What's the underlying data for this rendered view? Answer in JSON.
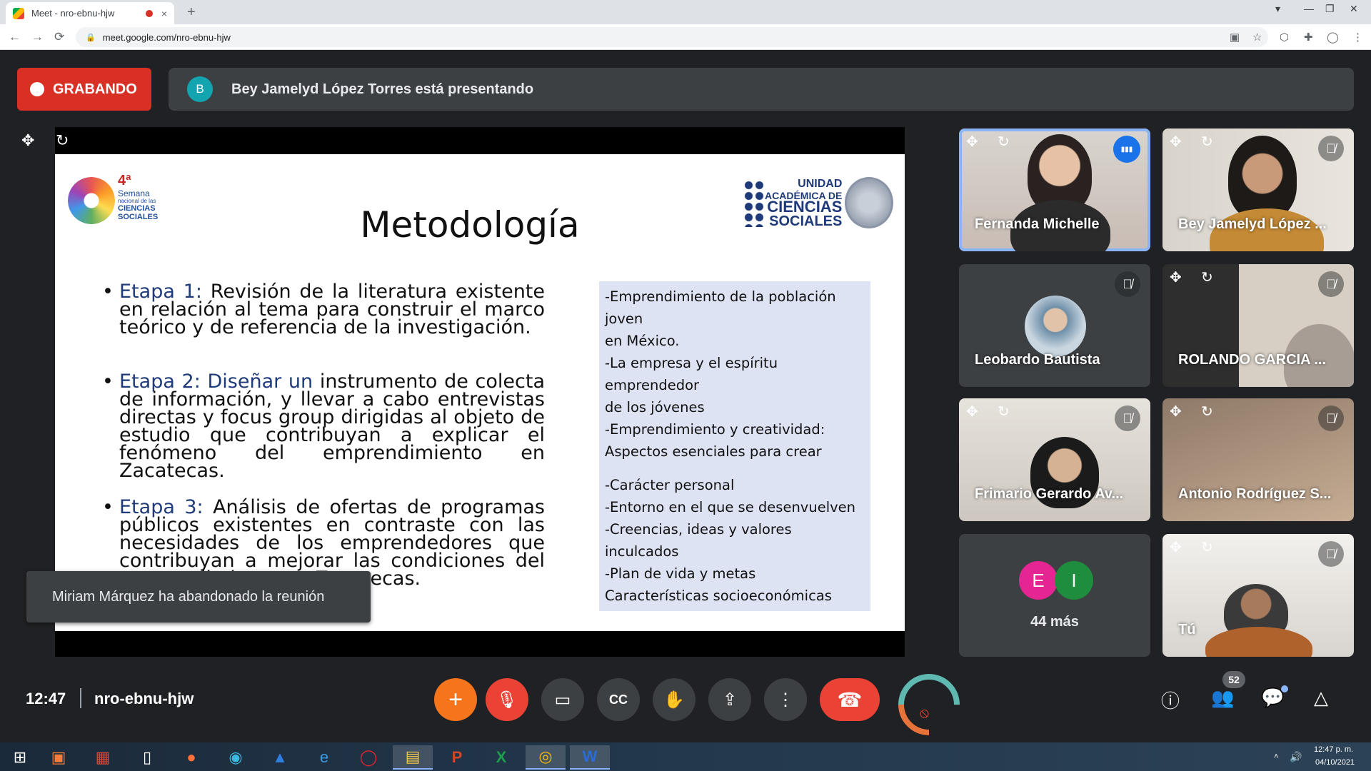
{
  "browser": {
    "tab_title": "Meet - nro-ebnu-hjw",
    "tab_close": "×",
    "new_tab": "+",
    "url": "meet.google.com/nro-ebnu-hjw",
    "lock_icon": "🔒",
    "nav": {
      "back": "←",
      "forward": "→",
      "reload": "⟳"
    },
    "window": {
      "dropdown": "▾",
      "minimize": "—",
      "restore": "❐",
      "close": "✕"
    },
    "extensions": {
      "camera": "▣",
      "star": "☆",
      "cube": "⬡",
      "puzzle": "✚",
      "profile": "◯",
      "menu": "⋮"
    }
  },
  "top": {
    "recording_label": "GRABANDO",
    "presenter_initial": "B",
    "presenter_text": "Bey Jamelyd López Torres está presentando"
  },
  "presentation": {
    "move_icon": "✥",
    "rotate_icon": "↻"
  },
  "slide": {
    "title": "Metodología",
    "logo_left": {
      "line1": "4ª",
      "line2": "Semana",
      "line3": "nacional de las",
      "line4": "CIENCIAS",
      "line5": "SOCIALES"
    },
    "logo_right": {
      "line1": "UNIDAD",
      "line2": "ACADÉMICA DE",
      "line3": "CIENCIAS",
      "line4": "SOCIALES"
    },
    "bullets": [
      {
        "key": "Etapa 1:",
        "text": " Revisión de la literatura existente en relación al tema para construir el marco teórico y de referencia de la investigación."
      },
      {
        "key": "Etapa 2: Diseñar un",
        "text": " instrumento de colecta de información, y llevar a cabo entrevistas directas y focus group dirigidas al objeto de estudio que contribuyan a explicar el fenómeno del emprendimiento en Zacatecas."
      },
      {
        "key": "Etapa 3:",
        "text": " Análisis de ofertas de programas públicos existentes en contraste con las necesidades de los emprendedores que contribuyan a mejorar las condiciones del emprendimiento en Zacatecas."
      }
    ],
    "box1": [
      "-Emprendimiento de la población joven",
      "en México.",
      "-La empresa y el espíritu emprendedor",
      "de los jóvenes",
      "-Emprendimiento y creatividad:",
      "Aspectos esenciales para crear empresa"
    ],
    "box2": [
      "-Carácter personal",
      "-Entorno en el que se desenvuelven",
      "-Creencias, ideas y valores inculcados",
      "-Plan de vida y metas",
      "Características socioeconómicas"
    ]
  },
  "toast": "Miriam Márquez ha abandonado la reunión",
  "participants": [
    {
      "name": "Fernanda Michelle"
    },
    {
      "name": "Bey Jamelyd López ..."
    },
    {
      "name": "Leobardo Bautista"
    },
    {
      "name": "ROLANDO GARCIA ..."
    },
    {
      "name": "Frimario Gerardo Av..."
    },
    {
      "name": "Antonio Rodríguez S..."
    },
    {
      "initials": [
        "E",
        "I"
      ],
      "label": "44 más"
    },
    {
      "name": "Tú"
    }
  ],
  "icons": {
    "mic_off": "🎙̸",
    "speaking": "▮▮▮",
    "watermark": "manycam"
  },
  "bottom": {
    "time": "12:47",
    "meeting_code": "nro-ebnu-hjw",
    "add": "+",
    "mic": "🎙",
    "camera": "▭",
    "captions": "CC",
    "hand": "✋",
    "present": "⇪",
    "more": "⋮",
    "hangup": "☎",
    "info": "ⓘ",
    "people": "👥",
    "people_count": "52",
    "chat": "💬",
    "activities": "△"
  },
  "taskbar": {
    "start": "⊞",
    "apps": [
      "▣",
      "▦",
      "▯",
      "●",
      "◉",
      "▲",
      "e",
      "◯",
      "▤",
      "P",
      "X",
      "◎",
      "W"
    ],
    "time": "12:47 p. m.",
    "date": "04/10/2021",
    "tray_arrow": "˄",
    "volume": "🔊"
  },
  "colors": {
    "recording": "#d93025",
    "presenter_avatar": "#12a4af",
    "active_border": "#8ab4f8",
    "add_button": "#f6751c",
    "hangup": "#ea4335",
    "avatar_E": "#e52592",
    "avatar_I": "#1e8e3e"
  }
}
